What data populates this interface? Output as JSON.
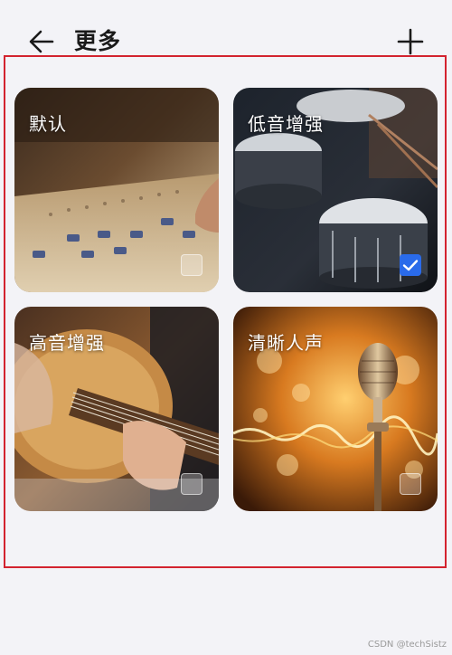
{
  "header": {
    "title": "更多",
    "back_icon": "arrow-left-icon",
    "add_icon": "plus-icon"
  },
  "effects": [
    {
      "label": "默认",
      "selected": false,
      "image": "mixing-console"
    },
    {
      "label": "低音增强",
      "selected": true,
      "image": "drum-kit"
    },
    {
      "label": "高音增强",
      "selected": false,
      "image": "acoustic-guitar"
    },
    {
      "label": "清晰人声",
      "selected": false,
      "image": "microphone"
    }
  ],
  "colors": {
    "highlight_border": "#d3232f",
    "check_selected": "#2a6bea",
    "background": "#f3f3f7"
  },
  "watermark": "CSDN @techSistz"
}
